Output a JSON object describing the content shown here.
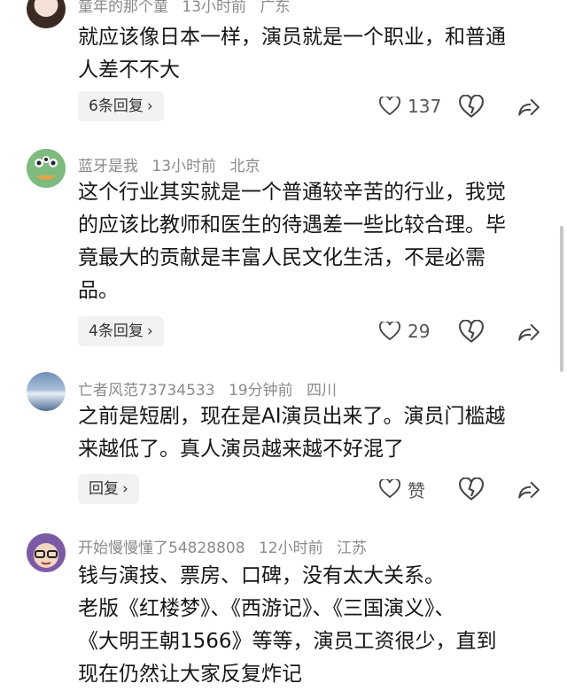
{
  "comments": [
    {
      "username": "童年的那个童",
      "time": "13小时前",
      "location": "广东",
      "text_lines": [
        "就应该像日本一样，演员就是一个职业，和普通",
        "人差不不大"
      ],
      "reply_label": "6条回复",
      "likes": "137"
    },
    {
      "username": "蓝牙是我",
      "time": "13小时前",
      "location": "北京",
      "text_lines": [
        "这个行业其实就是一个普通较辛苦的行业，我觉",
        "的应该比教师和医生的待遇差一些比较合理。毕",
        "竟最大的贡献是丰富人民文化生活，不是必需",
        "品。"
      ],
      "reply_label": "4条回复",
      "likes": "29"
    },
    {
      "username": "亡者风范73734533",
      "time": "19分钟前",
      "location": "四川",
      "text_lines": [
        "之前是短剧，现在是AI演员出来了。演员门槛越",
        "来越低了。真人演员越来越不好混了"
      ],
      "reply_label": "回复",
      "likes": "赞"
    },
    {
      "username": "开始慢慢懂了54828808",
      "time": "12小时前",
      "location": "江苏",
      "text_lines": [
        "钱与演技、票房、口碑，没有太大关系。",
        "老版《红楼梦》、《西游记》、《三国演义》、",
        "《大明王朝1566》等等，演员工资很少，直到",
        "现在仍然让大家反复炸记"
      ]
    }
  ],
  "colors": {
    "meta": "#8a8a8a",
    "text": "#161616",
    "reply_bg": "#f2f2f2"
  },
  "icons": [
    "heart-icon",
    "dislike-heart-icon",
    "share-icon",
    "chevron-right-icon"
  ]
}
